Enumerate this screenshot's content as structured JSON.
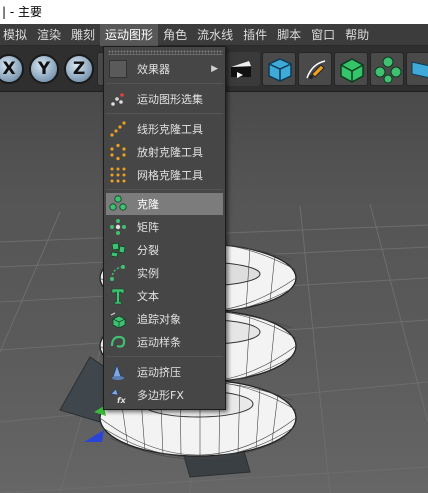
{
  "window": {
    "title": "| - 主要"
  },
  "menubar": {
    "items": [
      "模拟",
      "渲染",
      "雕刻",
      "运动图形",
      "角色",
      "流水线",
      "插件",
      "脚本",
      "窗口",
      "帮助"
    ],
    "active_index": 3
  },
  "toolbar": {
    "axis_buttons": [
      "X",
      "Y",
      "Z"
    ]
  },
  "dropdown": {
    "items": [
      {
        "label": "效果器",
        "icon": "submenu-icon",
        "submenu": true
      },
      {
        "label": "运动图形选集",
        "icon": "mograph-selection-icon"
      },
      {
        "label": "线形克隆工具",
        "icon": "linear-clone-icon"
      },
      {
        "label": "放射克隆工具",
        "icon": "radial-clone-icon"
      },
      {
        "label": "网格克隆工具",
        "icon": "grid-clone-icon"
      },
      {
        "label": "克隆",
        "icon": "cloner-icon",
        "highlighted": true
      },
      {
        "label": "矩阵",
        "icon": "matrix-icon"
      },
      {
        "label": "分裂",
        "icon": "fracture-icon"
      },
      {
        "label": "实例",
        "icon": "instance-icon"
      },
      {
        "label": "文本",
        "icon": "text-icon"
      },
      {
        "label": "追踪对象",
        "icon": "tracer-icon"
      },
      {
        "label": "运动样条",
        "icon": "mospline-icon"
      },
      {
        "label": "运动挤压",
        "icon": "moextrude-icon"
      },
      {
        "label": "多边形FX",
        "icon": "polyfx-icon"
      }
    ],
    "submenu_arrow": "▶"
  }
}
